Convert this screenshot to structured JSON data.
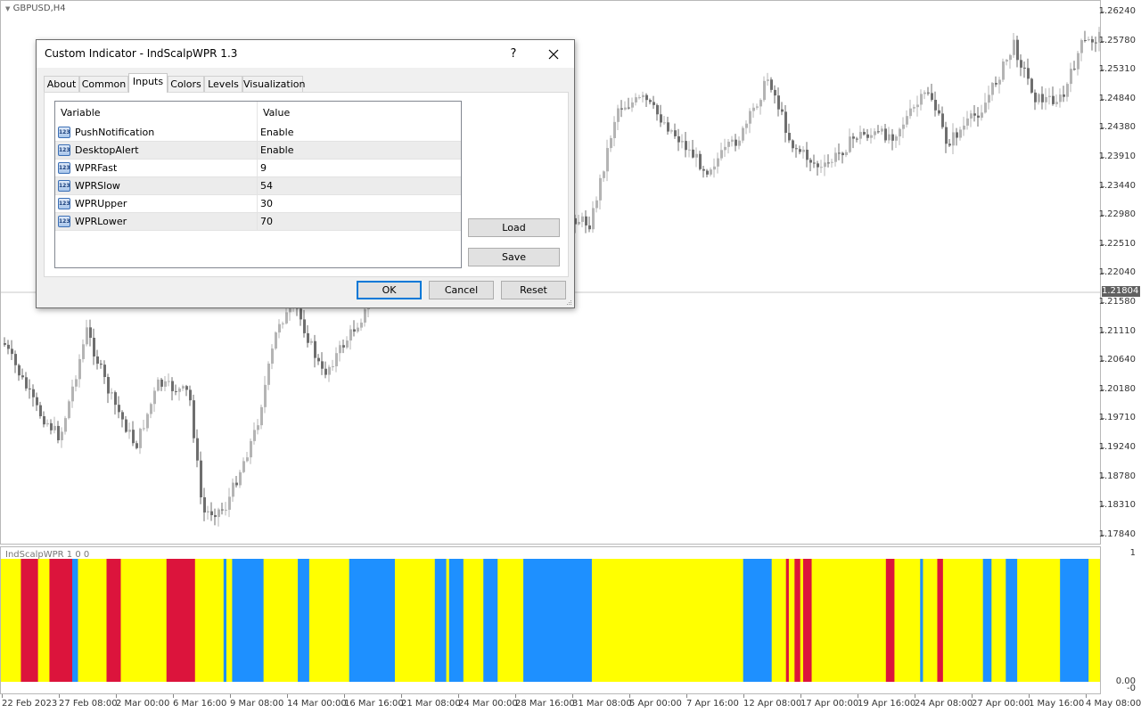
{
  "chart": {
    "symbol_title": "GBPUSD,H4",
    "price_ticks": [
      "1.26240",
      "1.25780",
      "1.25310",
      "1.24840",
      "1.24380",
      "1.23910",
      "1.23440",
      "1.22980",
      "1.22510",
      "1.22040",
      "1.21580",
      "1.21110",
      "1.20640",
      "1.20180",
      "1.19710",
      "1.19240",
      "1.18780",
      "1.18310",
      "1.17840"
    ],
    "current_price": "1.21804",
    "time_labels": [
      "22 Feb 2023",
      "27 Feb 08:00",
      "2 Mar 00:00",
      "6 Mar 16:00",
      "9 Mar 08:00",
      "14 Mar 00:00",
      "16 Mar 16:00",
      "21 Mar 08:00",
      "24 Mar 00:00",
      "28 Mar 16:00",
      "31 Mar 08:00",
      "5 Apr 00:00",
      "7 Apr 16:00",
      "12 Apr 08:00",
      "17 Apr 00:00",
      "19 Apr 16:00",
      "24 Apr 08:00",
      "27 Apr 00:00",
      "1 May 16:00",
      "4 May 08:00"
    ],
    "colors": {
      "bull_candle": "#b4b4b4",
      "bear_candle": "#6e6e6e",
      "grid_line": "#c8c8c8"
    }
  },
  "indicator": {
    "title": "IndScalpWPR 1 0 0",
    "axis_top": "1",
    "axis_bottom": "0.00",
    "axis_bottom2": "-0",
    "colors": {
      "yellow": "#ffff00",
      "blue": "#1e90ff",
      "red": "#dc143c"
    },
    "color_sequence": "yyyyyyyrrrrrryyyyrrrrrrrrbbyyyyyyyyyyrrrrryyyyyyyyyyyyyyyyrrrrrrrrrryyyyyyyyyybyybbbbbbbbbbbyyyyyyyyyyyybbbbyyyyyyyyyyyyyybbbbbbbbbbbbbbbbyyyyyyyyyyyyyybbbbybbbbbyyyyyyybbbbbyyyyyyyyybbbbbbbbbbbbbbbbbbbbbbbbyyyyyyyyyyyyyyyyyyyyyyyyyyyyyyyyyyyyyyyyyyyyyyyyyyyyybbbbbbbbbbyyyyyryyrryrrryyyyyyyyyyyyyyyyyyyyyyyyyyrrryyyyyyyyybyyyyyrryyyyyyyyyyyyyybbbyyyyybbbbyyyyyyyyyyyyyyybbbbbbbbbbyyyy"
  },
  "dialog": {
    "title": "Custom Indicator - IndScalpWPR 1.3",
    "help_label": "?",
    "close_icon": "close-icon",
    "tabs": [
      "About",
      "Common",
      "Inputs",
      "Colors",
      "Levels",
      "Visualization"
    ],
    "active_tab": "Inputs",
    "table": {
      "col_variable": "Variable",
      "col_value": "Value",
      "rows": [
        {
          "variable": "PushNotification",
          "value": "Enable",
          "icon": "123"
        },
        {
          "variable": "DesktopAlert",
          "value": "Enable",
          "icon": "123"
        },
        {
          "variable": "WPRFast",
          "value": "9",
          "icon": "123"
        },
        {
          "variable": "WPRSlow",
          "value": "54",
          "icon": "123"
        },
        {
          "variable": "WPRUpper",
          "value": "30",
          "icon": "123"
        },
        {
          "variable": "WPRLower",
          "value": "70",
          "icon": "123"
        }
      ]
    },
    "load_label": "Load",
    "save_label": "Save",
    "ok_label": "OK",
    "cancel_label": "Cancel",
    "reset_label": "Reset"
  }
}
